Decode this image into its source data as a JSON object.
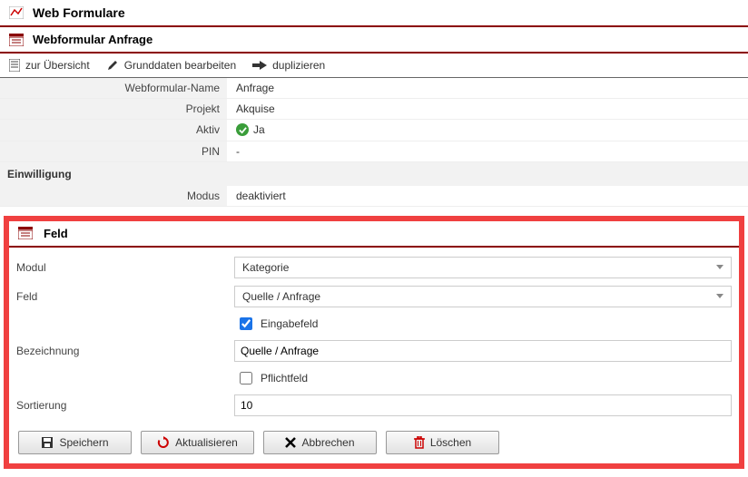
{
  "page": {
    "title": "Web Formulare"
  },
  "sub": {
    "title": "Webformular Anfrage"
  },
  "actions": {
    "overview": "zur Übersicht",
    "edit": "Grunddaten bearbeiten",
    "duplicate": "duplizieren"
  },
  "details": {
    "rows": {
      "name_label": "Webformular-Name",
      "name_value": "Anfrage",
      "project_label": "Projekt",
      "project_value": "Akquise",
      "active_label": "Aktiv",
      "active_value": "Ja",
      "pin_label": "PIN",
      "pin_value": "-"
    },
    "section_einwilligung": "Einwilligung",
    "modus_label": "Modus",
    "modus_value": "deaktiviert"
  },
  "feld": {
    "title": "Feld",
    "modul_label": "Modul",
    "modul_value": "Kategorie",
    "feld_label": "Feld",
    "feld_value": "Quelle / Anfrage",
    "eingabefeld_label": "Eingabefeld",
    "eingabefeld_checked": true,
    "bezeichnung_label": "Bezeichnung",
    "bezeichnung_value": "Quelle / Anfrage",
    "pflichtfeld_label": "Pflichtfeld",
    "pflichtfeld_checked": false,
    "sortierung_label": "Sortierung",
    "sortierung_value": "10"
  },
  "buttons": {
    "save": "Speichern",
    "refresh": "Aktualisieren",
    "cancel": "Abbrechen",
    "delete": "Löschen"
  }
}
